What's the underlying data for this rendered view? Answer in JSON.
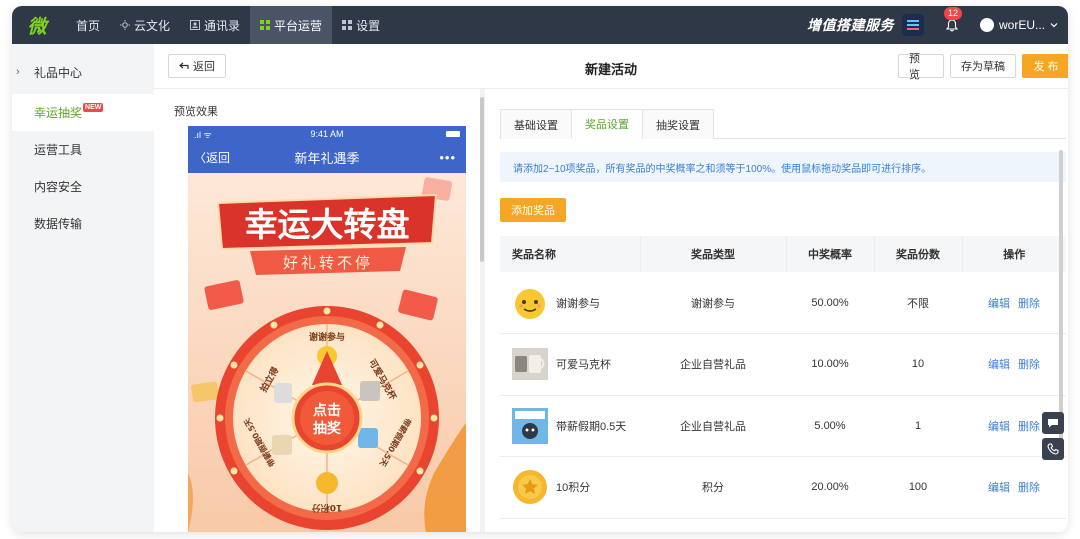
{
  "topnav": {
    "logo": "微",
    "items": [
      {
        "label": "首页",
        "icon": "none"
      },
      {
        "label": "云文化",
        "icon": "sun-icon"
      },
      {
        "label": "通讯录",
        "icon": "contacts-icon"
      },
      {
        "label": "平台运营",
        "icon": "grid-icon",
        "active": true
      },
      {
        "label": "设置",
        "icon": "grid-icon"
      }
    ],
    "value_added": "增值搭建服务",
    "notification_count": "12",
    "user_name": "worEU...",
    "colors": {
      "bar": "#2f3847",
      "active": "#4a5466",
      "accent": "#7ed321"
    }
  },
  "sidebar": {
    "items": [
      {
        "label": "礼品中心",
        "expandable": true
      },
      {
        "label": "幸运抽奖",
        "badge": "NEW",
        "active": true
      },
      {
        "label": "运营工具"
      },
      {
        "label": "内容安全"
      },
      {
        "label": "数据传输"
      }
    ]
  },
  "header": {
    "back_label": "返回",
    "title": "新建活动",
    "preview_label": "预 览",
    "draft_label": "存为草稿",
    "publish_label": "发 布"
  },
  "preview": {
    "section_label": "预览效果",
    "status_signal": ".ıl ᯤ",
    "status_time": "9:41 AM",
    "nav_back": "〈返回",
    "nav_title": "新年礼遇季",
    "nav_more": "•••",
    "banner_title": "幸运大转盘",
    "banner_subtitle": "好礼转不停",
    "wheel_center": [
      "点击",
      "抽奖"
    ],
    "wheel_labels": [
      "谢谢参与",
      "可爱马克杯",
      "带薪假期0.5天",
      "10积分",
      "带薪假期0.5天",
      "拍立得"
    ]
  },
  "tabs": [
    {
      "label": "基础设置"
    },
    {
      "label": "奖品设置",
      "active": true
    },
    {
      "label": "抽奖设置"
    }
  ],
  "notice": "请添加2~10项奖品，所有奖品的中奖概率之和须等于100%。使用鼠标拖动奖品即可进行排序。",
  "add_prize_label": "添加奖品",
  "table": {
    "headers": [
      "奖品名称",
      "奖品类型",
      "中奖概率",
      "奖品份数",
      "操作"
    ],
    "rows": [
      {
        "name": "谢谢参与",
        "type": "谢谢参与",
        "prob": "50.00%",
        "count": "不限",
        "icon": "smiley-icon"
      },
      {
        "name": "可爱马克杯",
        "type": "企业自营礼品",
        "prob": "10.00%",
        "count": "10",
        "icon": "mug-icon"
      },
      {
        "name": "带薪假期0.5天",
        "type": "企业自营礼品",
        "prob": "5.00%",
        "count": "1",
        "icon": "vacation-icon"
      },
      {
        "name": "10积分",
        "type": "积分",
        "prob": "20.00%",
        "count": "100",
        "icon": "coin-icon"
      }
    ],
    "edit_label": "编辑",
    "delete_label": "删除"
  }
}
